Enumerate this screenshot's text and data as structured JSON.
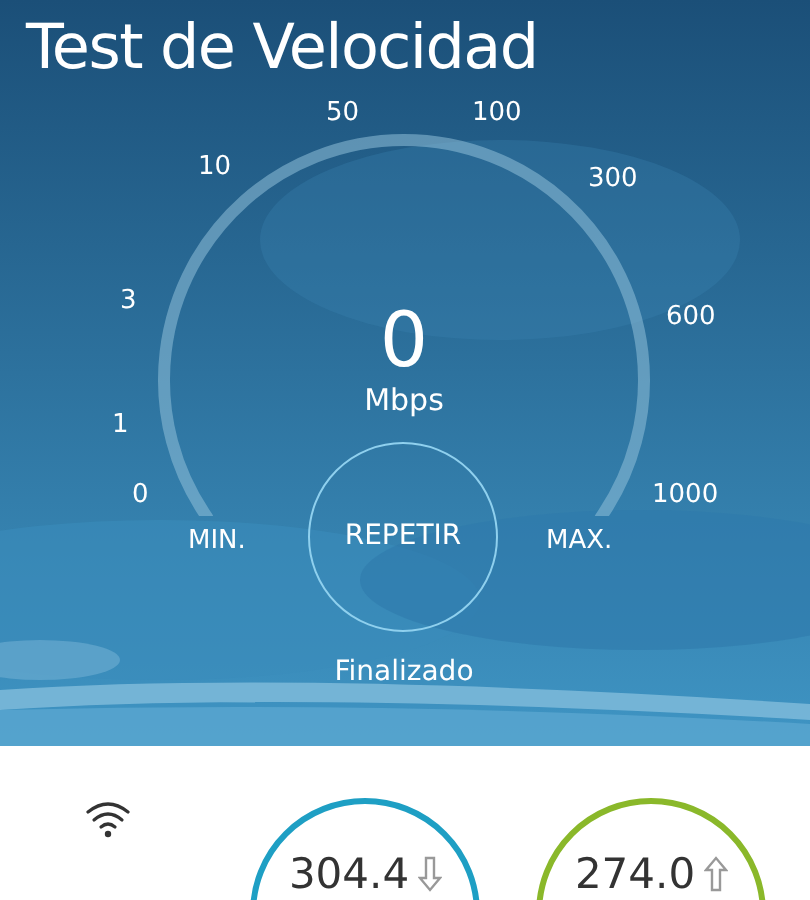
{
  "title": "Test de Velocidad",
  "gauge": {
    "ticks": [
      "0",
      "1",
      "3",
      "10",
      "50",
      "100",
      "300",
      "600",
      "1000"
    ],
    "value": "0",
    "unit": "Mbps",
    "min_label": "MIN.",
    "max_label": "MAX.",
    "button": "REPETIR",
    "status": "Finalizado"
  },
  "results": [
    {
      "kind": "download",
      "value": "304.4",
      "color": "#1e9fc4"
    },
    {
      "kind": "upload",
      "value": "274.0",
      "color": "#8ab82a"
    }
  ]
}
